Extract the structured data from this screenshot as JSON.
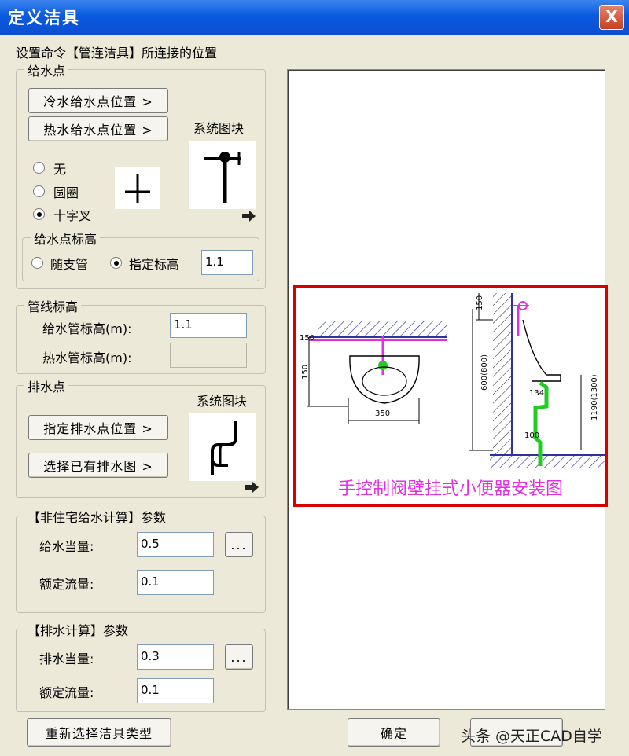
{
  "window": {
    "title": "定义洁具",
    "close_label": "X"
  },
  "header_text": "设置命令【管连洁具】所连接的位置",
  "supply": {
    "legend": "给水点",
    "cold_btn": "冷水给水点位置 >",
    "hot_btn": "热水给水点位置 >",
    "system_block_label": "系统图块",
    "radios": [
      {
        "label": "无",
        "checked": false
      },
      {
        "label": "圆圈",
        "checked": false
      },
      {
        "label": "十字叉",
        "checked": true
      }
    ],
    "elevation": {
      "legend": "给水点标高",
      "radio_follow": "随支管",
      "radio_fixed": "指定标高",
      "value": "1.1"
    }
  },
  "pipe_elev": {
    "legend": "管线标高",
    "cold_label": "给水管标高(m):",
    "cold_value": "1.1",
    "hot_label": "热水管标高(m):",
    "hot_value": ""
  },
  "drain": {
    "legend": "排水点",
    "system_block_label": "系统图块",
    "set_btn": "指定排水点位置 >",
    "select_btn": "选择已有排水图 >"
  },
  "nonres": {
    "legend": "【非住宅给水计算】参数",
    "eq_label": "给水当量:",
    "eq_value": "0.5",
    "flow_label": "额定流量:",
    "flow_value": "0.1",
    "more_btn": "..."
  },
  "drain_calc": {
    "legend": "【排水计算】参数",
    "eq_label": "排水当量:",
    "eq_value": "0.3",
    "flow_label": "额定流量:",
    "flow_value": "0.1",
    "more_btn": "..."
  },
  "buttons": {
    "reselect": "重新选择洁具类型",
    "ok": "确定"
  },
  "drawing": {
    "caption": "手控制阀壁挂式小便器安装图",
    "dim_width": "350",
    "dim_side": "150",
    "dim_bottom": "100",
    "dim_total": "600(800)",
    "dim_inner": "134",
    "dim_right": "1190(1300)",
    "dim_left": "150"
  },
  "watermark": "头条 @天正CAD自学",
  "colors": {
    "title_bar": "#0a5ae0",
    "frame_red": "#d70000",
    "caption_magenta": "#e030e0",
    "pipe_green": "#22cc22"
  }
}
